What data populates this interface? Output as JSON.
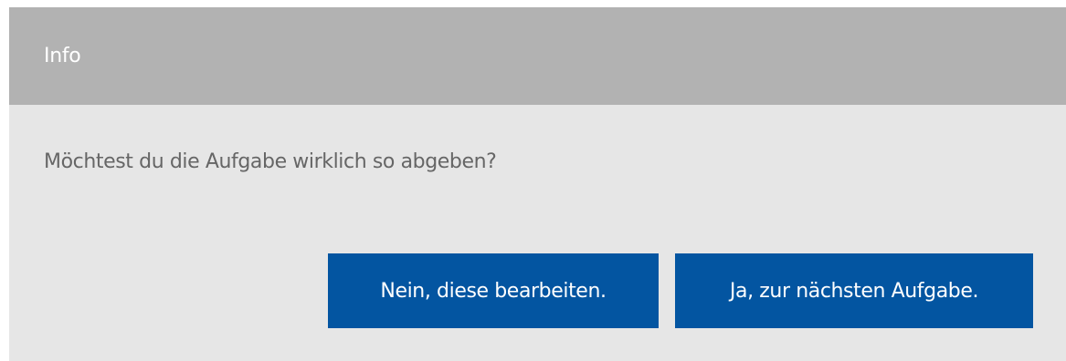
{
  "dialog": {
    "title": "Info",
    "message": "Möchtest du die Aufgabe wirklich so abgeben?",
    "buttons": {
      "no_label": "Nein, diese bearbeiten.",
      "yes_label": "Ja, zur nächsten Aufgabe."
    }
  },
  "colors": {
    "header_bg": "#b2b2b2",
    "body_bg": "#e6e6e6",
    "button_bg": "#0355a1",
    "message_text": "#666666"
  }
}
